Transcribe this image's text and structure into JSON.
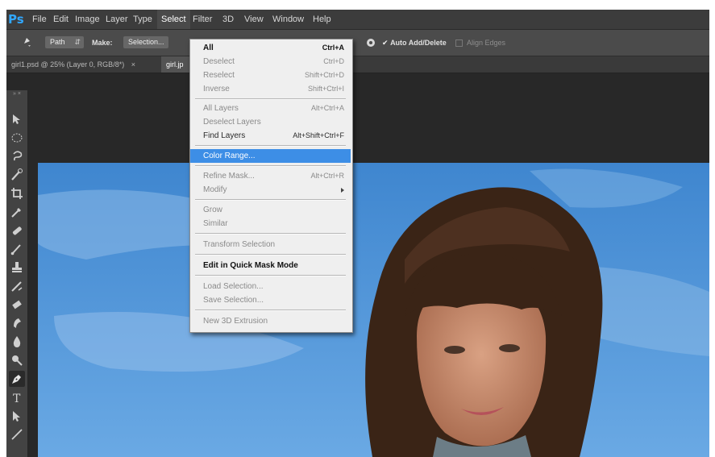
{
  "app": {
    "logo": "Ps"
  },
  "menubar": {
    "items": [
      "File",
      "Edit",
      "Image",
      "Layer",
      "Type",
      "Select",
      "Filter",
      "3D",
      "View",
      "Window",
      "Help"
    ],
    "active": "Select"
  },
  "options": {
    "mode": "Path",
    "make_label": "Make:",
    "selection_button": "Selection...",
    "auto_add_delete": "Auto Add/Delete",
    "auto_add_delete_checked": true,
    "align_edges": "Align Edges",
    "align_edges_checked": false
  },
  "tabs": [
    {
      "label": "girl1.psd @ 25% (Layer 0, RGB/8*)",
      "close": "×"
    },
    {
      "label": "girl.jp"
    }
  ],
  "toolbar": {
    "header": "»  ×",
    "tools": [
      "move-icon",
      "marquee-icon",
      "lasso-icon",
      "quick-selection-icon",
      "crop-icon",
      "eyedropper-icon",
      "healing-brush-icon",
      "brush-icon",
      "clone-stamp-icon",
      "history-brush-icon",
      "eraser-icon",
      "gradient-icon",
      "blur-icon",
      "dodge-icon",
      "pen-icon",
      "type-icon",
      "path-selection-icon",
      "shape-icon"
    ],
    "active_tool": "pen-icon"
  },
  "select_menu": {
    "items": [
      {
        "label": "All",
        "shortcut": "Ctrl+A",
        "state": "bold"
      },
      {
        "label": "Deselect",
        "shortcut": "Ctrl+D",
        "state": "dim"
      },
      {
        "label": "Reselect",
        "shortcut": "Shift+Ctrl+D",
        "state": "dim"
      },
      {
        "label": "Inverse",
        "shortcut": "Shift+Ctrl+I",
        "state": "dim"
      },
      {
        "label": "All Layers",
        "shortcut": "Alt+Ctrl+A",
        "state": "dim"
      },
      {
        "label": "Deselect Layers",
        "shortcut": "",
        "state": "dim"
      },
      {
        "label": "Find Layers",
        "shortcut": "Alt+Shift+Ctrl+F",
        "state": "normal"
      },
      {
        "label": "Color Range...",
        "shortcut": "",
        "state": "highlighted"
      },
      {
        "label": "Refine Mask...",
        "shortcut": "Alt+Ctrl+R",
        "state": "dim"
      },
      {
        "label": "Modify",
        "shortcut": "",
        "state": "dim",
        "submenu": true
      },
      {
        "label": "Grow",
        "shortcut": "",
        "state": "dim"
      },
      {
        "label": "Similar",
        "shortcut": "",
        "state": "dim"
      },
      {
        "label": "Transform Selection",
        "shortcut": "",
        "state": "dim"
      },
      {
        "label": "Edit in Quick Mask Mode",
        "shortcut": "",
        "state": "bold"
      },
      {
        "label": "Load Selection...",
        "shortcut": "",
        "state": "dim"
      },
      {
        "label": "Save Selection...",
        "shortcut": "",
        "state": "dim"
      },
      {
        "label": "New 3D Extrusion",
        "shortcut": "",
        "state": "dim"
      }
    ]
  },
  "colors": {
    "ps_blue": "#31a8ff",
    "menu_highlight": "#3d8ee6",
    "sky": "#4b8fd3",
    "hair": "#3a2416"
  }
}
